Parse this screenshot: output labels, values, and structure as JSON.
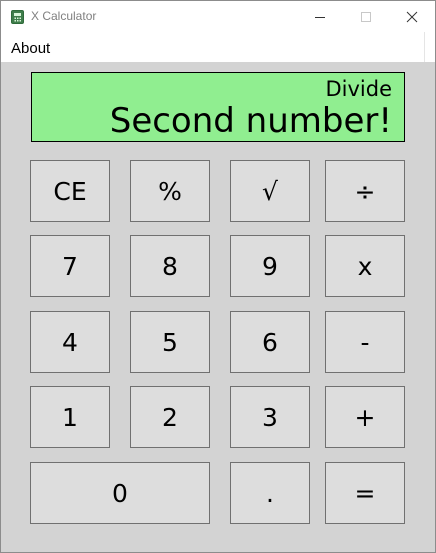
{
  "window": {
    "title": "X Calculator",
    "app_icon": "calculator-icon",
    "controls": [
      "minimize-icon",
      "maximize-icon",
      "close-icon"
    ]
  },
  "menu": {
    "about": "About"
  },
  "display": {
    "operation": "Divide",
    "value": "Second number!",
    "background": "#90ee90"
  },
  "keypad": {
    "row1": [
      "CE",
      "%",
      "√",
      "÷"
    ],
    "row2": [
      "7",
      "8",
      "9",
      "x"
    ],
    "row3": [
      "4",
      "5",
      "6",
      "-"
    ],
    "row4": [
      "1",
      "2",
      "3",
      "+"
    ],
    "row5": [
      "0",
      ".",
      "="
    ]
  },
  "colors": {
    "body_background": "#d3d3d3",
    "key_background": "#dddddd",
    "key_border": "#707070"
  }
}
